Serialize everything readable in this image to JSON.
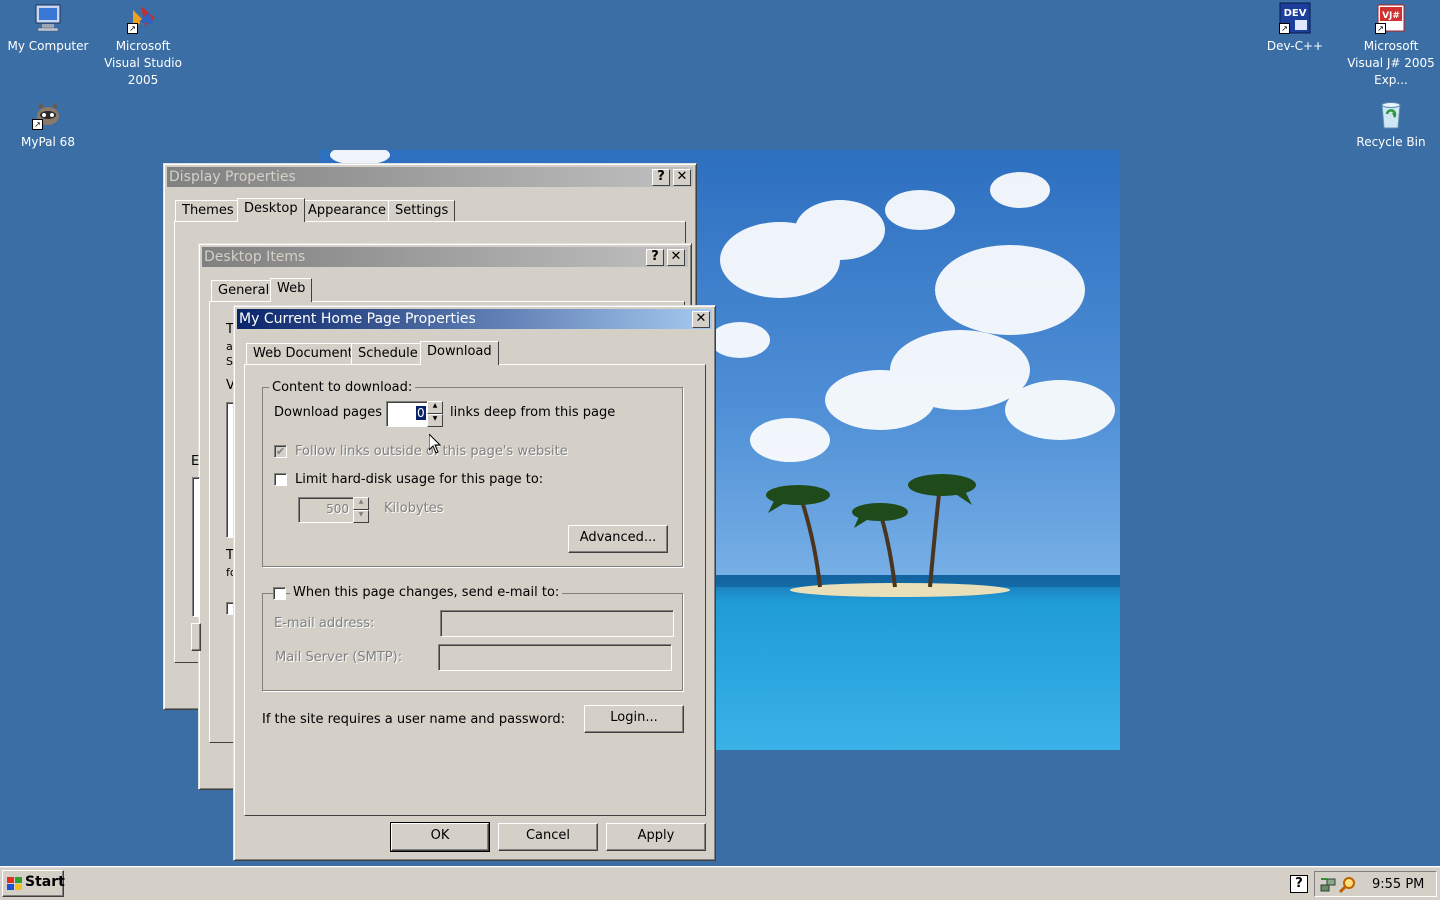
{
  "desktop": {
    "icons": [
      {
        "label": "My Computer"
      },
      {
        "label": "Microsoft Visual Studio 2005"
      },
      {
        "label": "MyPal 68"
      },
      {
        "label": "Dev-C++",
        "badge": "DEV"
      },
      {
        "label": "Microsoft Visual J# 2005 Exp...",
        "badge": "VJ#"
      },
      {
        "label": "Recycle Bin"
      }
    ]
  },
  "display_properties": {
    "title": "Display Properties",
    "tabs": [
      "Themes",
      "Desktop",
      "Appearance",
      "Settings"
    ],
    "selected_tab": "Desktop",
    "help_glyph": "?",
    "close_glyph": "✕"
  },
  "desktop_items": {
    "title": "Desktop Items",
    "tabs": [
      "General",
      "Web"
    ],
    "selected_tab": "Web",
    "peek_letters": [
      "T",
      "a",
      "S",
      "V",
      "E",
      "T",
      "fo"
    ]
  },
  "home_page_props": {
    "title": "My Current Home Page Properties",
    "close_glyph": "✕",
    "tabs": [
      "Web Document",
      "Schedule",
      "Download"
    ],
    "selected_tab": "Download",
    "content_group": {
      "legend": "Content to download:",
      "download_pages_label": "Download pages",
      "download_pages_value": "0",
      "links_deep_label": "links deep from this page",
      "follow_links_label": "Follow links outside of this page's website",
      "follow_links_checked": true,
      "limit_label": "Limit hard-disk usage for this page to:",
      "limit_checked": false,
      "kb_value": "500",
      "kb_label": "Kilobytes",
      "advanced_button": "Advanced..."
    },
    "email_group": {
      "checkbox_label": "When this page changes, send e-mail to:",
      "checked": false,
      "email_label": "E-mail address:",
      "smtp_label": "Mail Server (SMTP):"
    },
    "login_prompt": "If the site requires a user name and password:",
    "login_button": "Login...",
    "ok_button": "OK",
    "cancel_button": "Cancel",
    "apply_button": "Apply"
  },
  "taskbar": {
    "start_label": "Start",
    "clock": "9:55 PM",
    "help_glyph": "?"
  },
  "colors": {
    "desktop": "#3a6ea5",
    "face": "#d4d0c8",
    "active_title": "#0a246a"
  }
}
